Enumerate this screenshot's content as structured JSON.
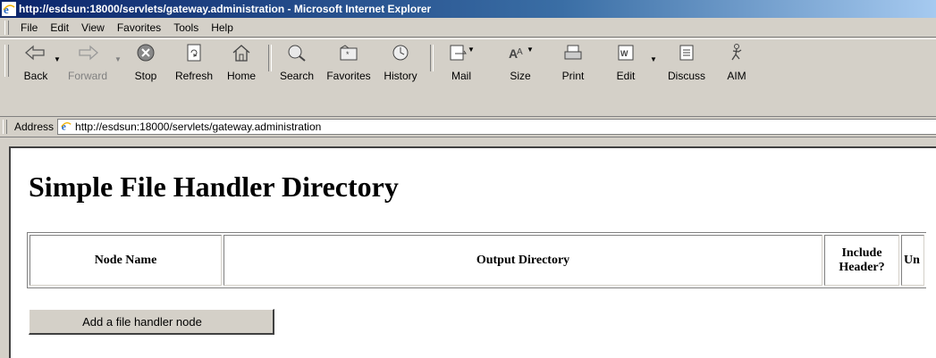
{
  "window": {
    "title": "http://esdsun:18000/servlets/gateway.administration - Microsoft Internet Explorer"
  },
  "menu": {
    "items": [
      "File",
      "Edit",
      "View",
      "Favorites",
      "Tools",
      "Help"
    ],
    "accelerators": [
      "F",
      "E",
      "V",
      "a",
      "T",
      "H"
    ]
  },
  "toolbar": {
    "back": "Back",
    "forward": "Forward",
    "stop": "Stop",
    "refresh": "Refresh",
    "home": "Home",
    "search": "Search",
    "favorites": "Favorites",
    "history": "History",
    "mail": "Mail",
    "size": "Size",
    "print": "Print",
    "edit": "Edit",
    "discuss": "Discuss",
    "aim": "AIM"
  },
  "address": {
    "label": "Address",
    "url": "http://esdsun:18000/servlets/gateway.administration"
  },
  "page": {
    "heading": "Simple File Handler Directory",
    "table": {
      "headers": [
        "Node Name",
        "Output Directory",
        "Include Header?",
        "Un"
      ]
    },
    "add_button": "Add a file handler node"
  },
  "colors": {
    "titlebar_start": "#0a246a",
    "titlebar_end": "#a6caf0",
    "chrome": "#d4d0c8"
  }
}
